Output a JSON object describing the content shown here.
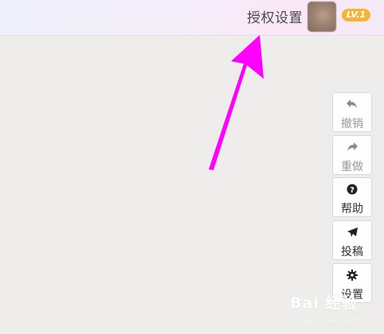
{
  "header": {
    "auth_settings_label": "授权设置",
    "level_badge": "LV.1"
  },
  "toolbar": {
    "undo_label": "撤销",
    "redo_label": "重做",
    "help_label": "帮助",
    "submit_label": "投稿",
    "settings_label": "设置"
  },
  "watermark": {
    "text": "Bai 经验",
    "sub": "jingyan.baidu.com"
  },
  "colors": {
    "annotation_arrow": "#ff00ff",
    "level_badge": "#f3b534",
    "disabled_text": "#9a9a9a",
    "enabled_text": "#333333"
  }
}
